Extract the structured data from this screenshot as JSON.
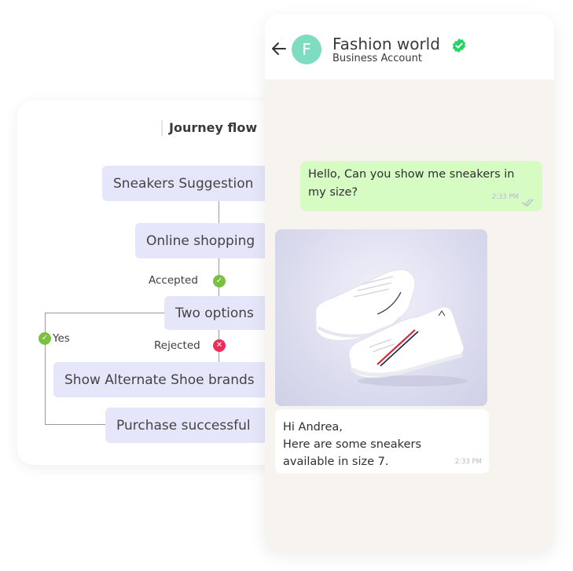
{
  "journey": {
    "title": "Journey flow",
    "nodes": [
      {
        "label": "Sneakers Suggestion"
      },
      {
        "label": "Online shopping"
      },
      {
        "label": "Two options"
      },
      {
        "label": "Show Alternate Shoe brands"
      },
      {
        "label": "Purchase successful"
      }
    ],
    "conditions": {
      "accepted": "Accepted",
      "rejected": "Rejected",
      "yes": "Yes"
    },
    "status_icons": {
      "accepted": "check-icon",
      "rejected": "cross-icon",
      "yes": "check-icon"
    },
    "colors": {
      "node_bg": "#e6e6fa",
      "success": "#7ac142",
      "error": "#ee2c58"
    }
  },
  "chat": {
    "header": {
      "back_icon": "arrow-left-icon",
      "avatar_letter": "F",
      "name": "Fashion world",
      "verified_icon": "verified-badge-icon",
      "subtitle": "Business Account"
    },
    "messages": [
      {
        "direction": "outgoing",
        "text_lines": [
          "Hello, Can you show me sneakers in",
          "my size?"
        ],
        "time": "2:33 PM",
        "status_icon": "double-check-icon"
      },
      {
        "direction": "incoming",
        "media": "sneakers-image",
        "text_lines": [
          "Hi Andrea,",
          "Here are some sneakers",
          "available in size 7."
        ],
        "time": "2:33 PM"
      }
    ],
    "colors": {
      "outgoing_bg": "#d6fcc4",
      "chat_bg": "#f7f4ef",
      "avatar_bg": "#7edcc0",
      "verified": "#25d366"
    }
  }
}
